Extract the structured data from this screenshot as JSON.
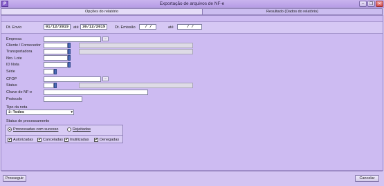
{
  "window": {
    "title": "Exportação de arquivos de NF-e",
    "app_icon": "P",
    "minimize": "–",
    "restore": "❐",
    "close": "✕"
  },
  "tabs": [
    {
      "label": "Opções do relatório",
      "active": true
    },
    {
      "label": "Resultado (Dados do relatório)",
      "active": false
    }
  ],
  "dates": {
    "envio_label": "Dt. Envio",
    "envio_from": "01/12/2019",
    "ate_label_1": "até",
    "envio_to": "30/12/2019",
    "emissao_label": "Dt. Emissão",
    "emissao_from": "/ /",
    "ate_label_2": "até",
    "emissao_to": "/ /"
  },
  "fields": {
    "empresa": "Empresa",
    "cliente": "Cliente / Fornecedor",
    "transportadora": "Transportadora",
    "nro_lote": "Nro. Lote",
    "id_nota": "ID Nota",
    "serie": "Série",
    "cfop": "CFOP",
    "status": "Status",
    "chave": "Chave de NF-e",
    "protocolo": "Protocolo",
    "lookup_glyph": "..."
  },
  "tipo_nota": {
    "label": "Tipo da nota",
    "value": "3-Todos",
    "arrow": "▾"
  },
  "status_processamento": {
    "label": "Status de processamento",
    "radios": [
      {
        "label": "Processadas com sucesso",
        "selected": true
      },
      {
        "label": "Rejeitadas",
        "selected": false
      }
    ],
    "checks": [
      {
        "label": "Autorizadas",
        "checked": true,
        "mark": "✓"
      },
      {
        "label": "Canceladas",
        "checked": true,
        "mark": "✓"
      },
      {
        "label": "Inutilizadas",
        "checked": true,
        "mark": "✓"
      },
      {
        "label": "Denegadas",
        "checked": true,
        "mark": "✓"
      }
    ]
  },
  "buttons": {
    "prosseguir": "Prosseguir",
    "cancelar": "Cancelar"
  }
}
